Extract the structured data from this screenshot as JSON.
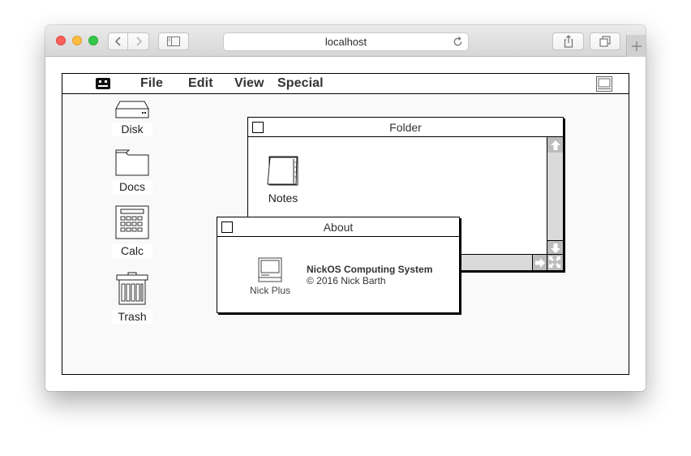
{
  "browser": {
    "url": "localhost"
  },
  "menubar": {
    "items": [
      {
        "label": "File"
      },
      {
        "label": "Edit"
      },
      {
        "label": "View"
      },
      {
        "label": "Special"
      }
    ]
  },
  "desktop": {
    "icons": [
      {
        "label": "Disk",
        "icon": "hard-disk-icon"
      },
      {
        "label": "Docs",
        "icon": "folder-icon"
      },
      {
        "label": "Calc",
        "icon": "calculator-icon"
      },
      {
        "label": "Trash",
        "icon": "trash-icon"
      }
    ]
  },
  "folder_window": {
    "title": "Folder",
    "items": [
      {
        "label": "Notes",
        "icon": "notepad-icon"
      }
    ]
  },
  "about_window": {
    "title": "About",
    "computer_label": "Nick Plus",
    "system_name": "NickOS Computing System",
    "copyright": "© 2016 Nick Barth"
  }
}
